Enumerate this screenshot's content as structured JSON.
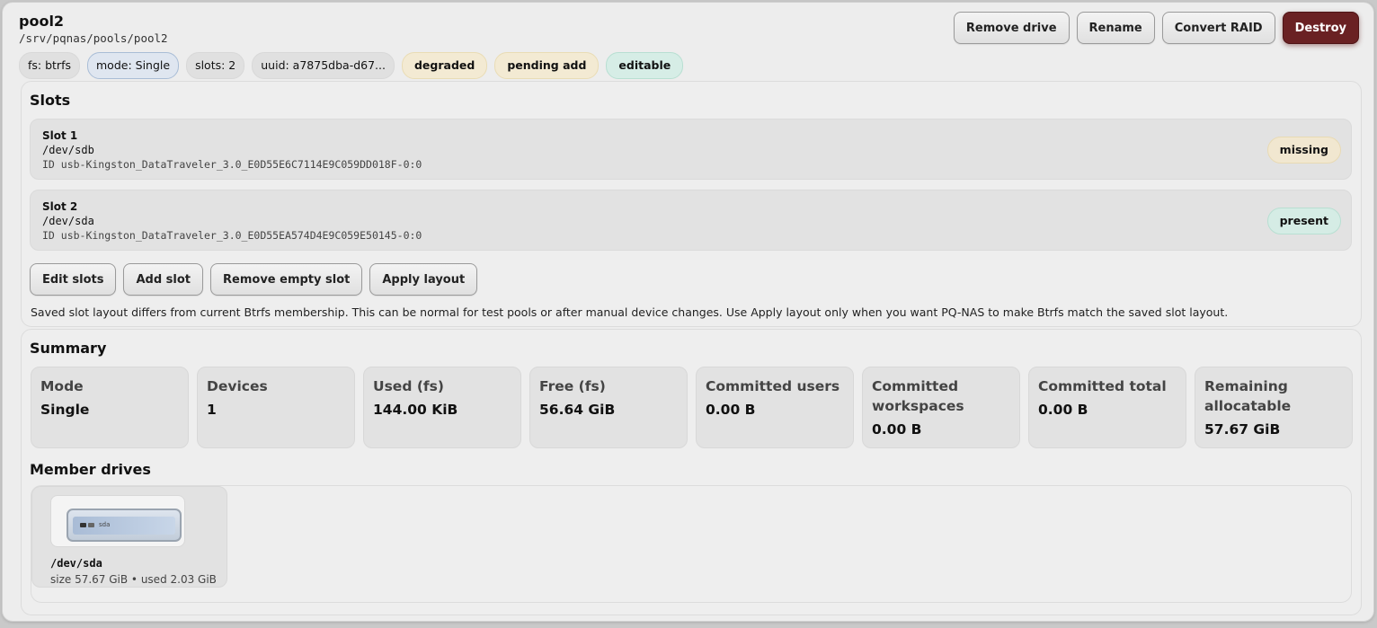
{
  "pool": {
    "name": "pool2",
    "path": "/srv/pqnas/pools/pool2"
  },
  "actions": {
    "remove_drive": "Remove drive",
    "rename": "Rename",
    "convert_raid": "Convert RAID",
    "destroy": "Destroy"
  },
  "badges": {
    "fs": "fs: btrfs",
    "mode": "mode: Single",
    "slots": "slots: 2",
    "uuid": "uuid: a7875dba-d67...",
    "degraded": "degraded",
    "pending_add": "pending add",
    "editable": "editable"
  },
  "slots_section": {
    "title": "Slots",
    "slots": [
      {
        "name": "Slot 1",
        "device": "/dev/sdb",
        "id": "ID usb-Kingston_DataTraveler_3.0_E0D55E6C7114E9C059DD018F-0:0",
        "status": "missing"
      },
      {
        "name": "Slot 2",
        "device": "/dev/sda",
        "id": "ID usb-Kingston_DataTraveler_3.0_E0D55EA574D4E9C059E50145-0:0",
        "status": "present"
      }
    ],
    "buttons": {
      "edit_slots": "Edit slots",
      "add_slot": "Add slot",
      "remove_empty_slot": "Remove empty slot",
      "apply_layout": "Apply layout"
    },
    "note": "Saved slot layout differs from current Btrfs membership. This can be normal for test pools or after manual device changes. Use Apply layout only when you want PQ-NAS to make Btrfs match the saved slot layout."
  },
  "summary": {
    "title": "Summary",
    "stats": [
      {
        "label": "Mode",
        "value": "Single"
      },
      {
        "label": "Devices",
        "value": "1"
      },
      {
        "label": "Used (fs)",
        "value": "144.00 KiB"
      },
      {
        "label": "Free (fs)",
        "value": "56.64 GiB"
      },
      {
        "label": "Committed users",
        "value": "0.00 B"
      },
      {
        "label": "Committed workspaces",
        "value": "0.00 B"
      },
      {
        "label": "Committed total",
        "value": "0.00 B"
      },
      {
        "label": "Remaining allocatable",
        "value": "57.67 GiB"
      }
    ],
    "member_drives_title": "Member drives",
    "drives": [
      {
        "tag": "sda",
        "device": "/dev/sda",
        "meta": "size 57.67 GiB • used 2.03 GiB"
      }
    ]
  }
}
